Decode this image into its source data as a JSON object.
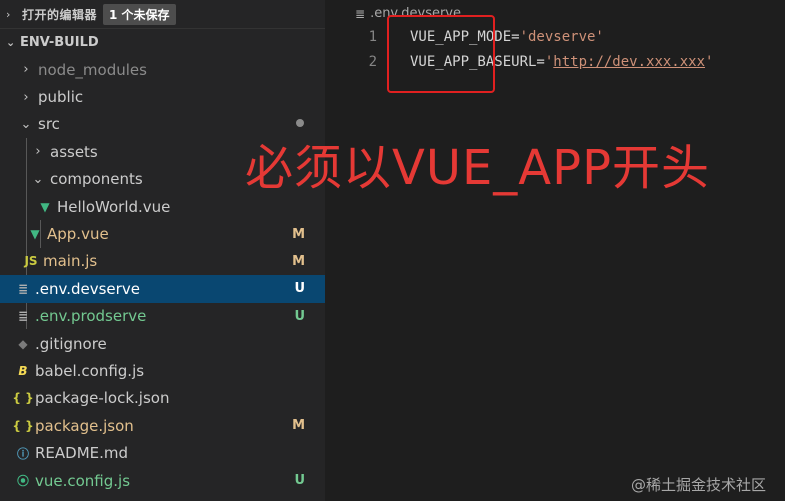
{
  "sidebar": {
    "open_editors": {
      "title": "打开的编辑器",
      "badge": "1 个未保存"
    },
    "project": {
      "name": "ENV-BUILD"
    },
    "tree": [
      {
        "label": "node_modules",
        "chevron": "›",
        "icon": "",
        "status": ""
      },
      {
        "label": "public",
        "chevron": "›",
        "icon": "",
        "status": ""
      },
      {
        "label": "src",
        "chevron": "⌄",
        "icon": "",
        "status": ""
      },
      {
        "label": "assets",
        "chevron": "›",
        "icon": "",
        "status": ""
      },
      {
        "label": "components",
        "chevron": "⌄",
        "icon": "",
        "status": ""
      },
      {
        "label": "HelloWorld.vue",
        "chevron": "",
        "icon": "vue-icon",
        "status": ""
      },
      {
        "label": "App.vue",
        "chevron": "",
        "icon": "vue-icon",
        "status": "M"
      },
      {
        "label": "main.js",
        "chevron": "",
        "icon": "js-icon",
        "status": "M"
      },
      {
        "label": ".env.devserve",
        "chevron": "",
        "icon": "env-file-icon",
        "status": "U"
      },
      {
        "label": ".env.prodserve",
        "chevron": "",
        "icon": "env-file-icon",
        "status": "U"
      },
      {
        "label": ".gitignore",
        "chevron": "",
        "icon": "git-icon",
        "status": ""
      },
      {
        "label": "babel.config.js",
        "chevron": "",
        "icon": "babel-icon",
        "status": ""
      },
      {
        "label": "package-lock.json",
        "chevron": "",
        "icon": "json-icon",
        "status": ""
      },
      {
        "label": "package.json",
        "chevron": "",
        "icon": "json-icon",
        "status": "M"
      },
      {
        "label": "README.md",
        "chevron": "",
        "icon": "info-icon",
        "status": ""
      },
      {
        "label": "vue.config.js",
        "chevron": "",
        "icon": "vue-config-icon",
        "status": "U"
      }
    ],
    "icon_glyphs": {
      "vue": "▼",
      "js": "JS",
      "env": "≣",
      "git": "◆",
      "babel": "B",
      "json": "{ }",
      "info": "ⓘ",
      "vuecfg": "⦿"
    }
  },
  "editor": {
    "breadcrumb": ".env.devserve",
    "lines": [
      {
        "number": "1",
        "key": "VUE_APP_MODE=",
        "value": "'devserve'"
      },
      {
        "number": "2",
        "key": "VUE_APP_BASEURL=",
        "value_quote_open": "'",
        "value_url": "http://dev.xxx.xxx",
        "value_quote_close": "'"
      }
    ],
    "annotation": "必须以VUE_APP开头"
  },
  "watermark": "@稀土掘金技术社区",
  "colors": {
    "sidebar_bg": "#252526",
    "editor_bg": "#1e1e1e",
    "selection": "#094771",
    "modified": "#e2c08d",
    "untracked": "#73c991",
    "annotation_red": "#e53935",
    "string": "#ce9178"
  }
}
